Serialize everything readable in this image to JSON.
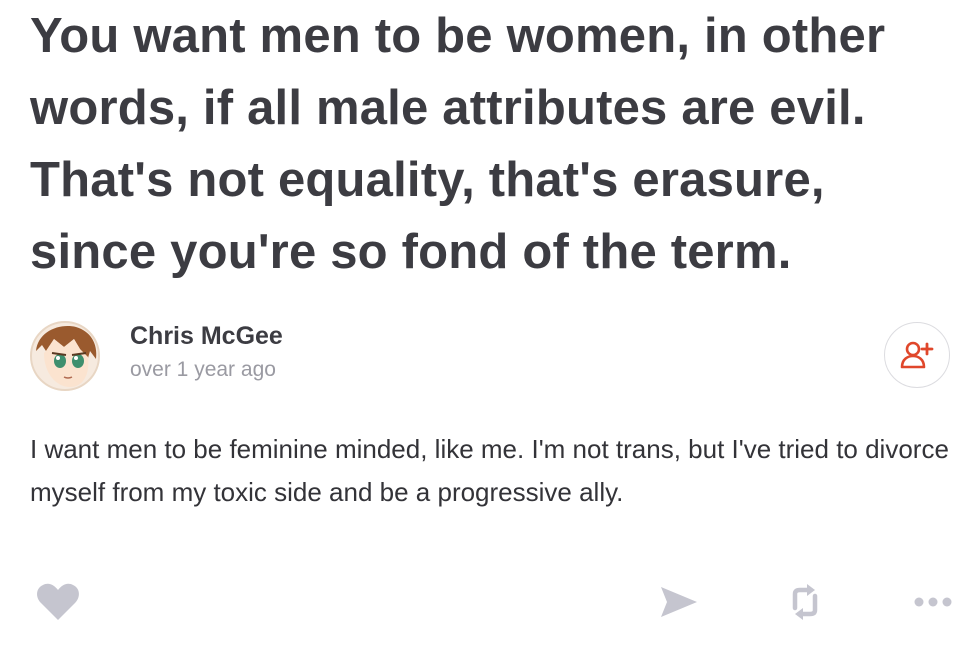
{
  "quote": {
    "text": "You want men to be women, in other words, if all male attributes are evil. That's not equality, that's erasure, since you're so fond of the term."
  },
  "post": {
    "author": "Chris McGee",
    "timestamp": "over 1 year ago",
    "body": "I want men to be feminine minded, like me. I'm not trans, but I've tried to divorce myself from my toxic side and be a progressive ally."
  },
  "icons": {
    "follow": "add-user-icon",
    "like": "heart-icon",
    "share": "send-icon",
    "reblog": "repost-icon",
    "more": "more-dots-icon"
  },
  "colors": {
    "follow_icon": "#e0472b",
    "action_icon": "#c5c5cf",
    "heading_text": "#3c3c42",
    "muted_text": "#9a9aa2"
  }
}
